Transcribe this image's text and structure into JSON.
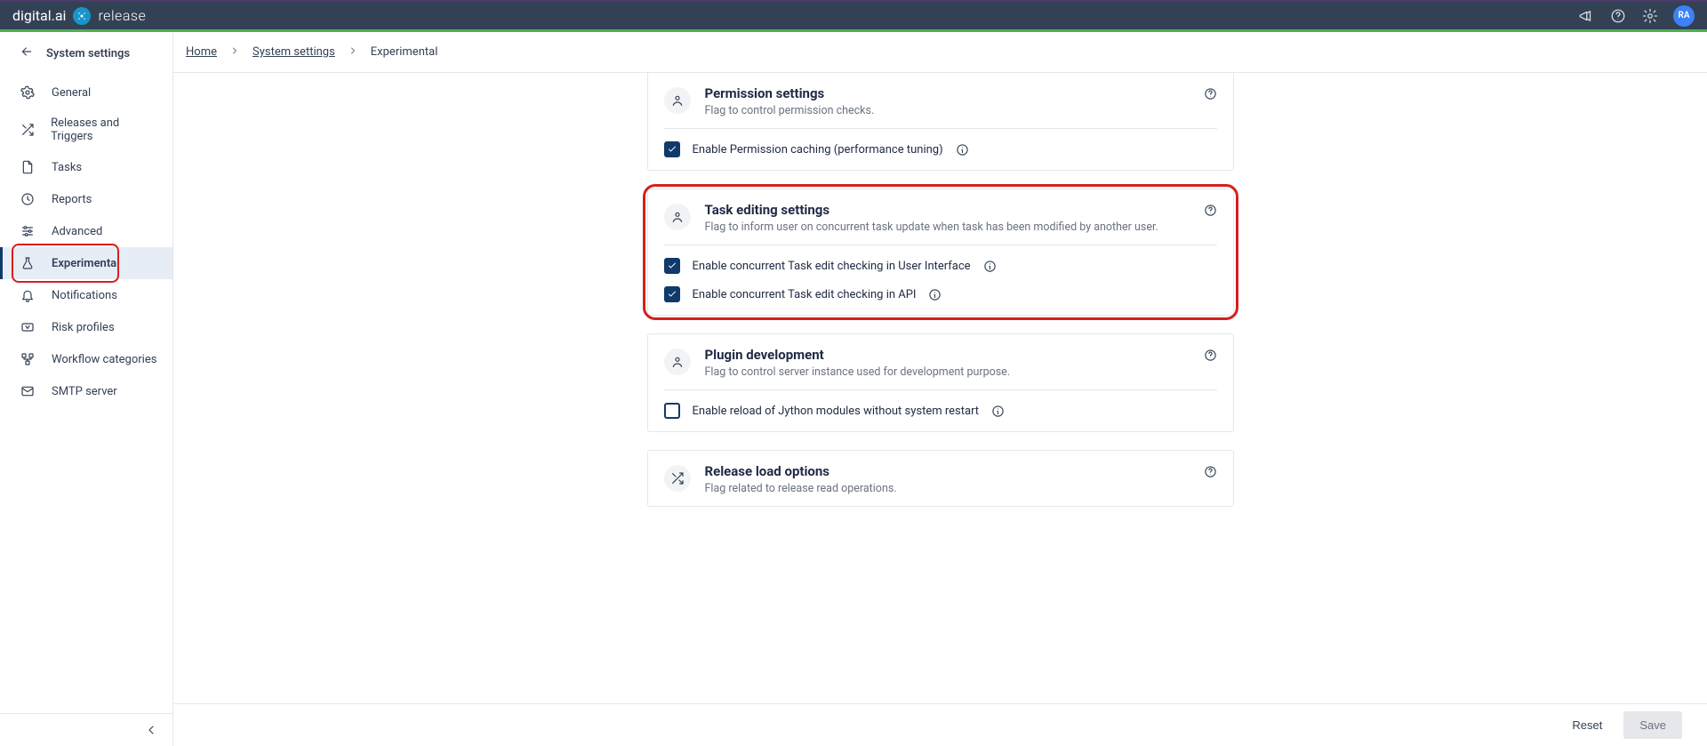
{
  "brand": {
    "main": "digital.ai",
    "product": "release"
  },
  "topbar": {
    "avatar_initials": "RA"
  },
  "sidebar": {
    "title": "System settings",
    "items": [
      {
        "label": "General"
      },
      {
        "label": "Releases and Triggers"
      },
      {
        "label": "Tasks"
      },
      {
        "label": "Reports"
      },
      {
        "label": "Advanced"
      },
      {
        "label": "Experimental"
      },
      {
        "label": "Notifications"
      },
      {
        "label": "Risk profiles"
      },
      {
        "label": "Workflow categories"
      },
      {
        "label": "SMTP server"
      }
    ]
  },
  "breadcrumbs": {
    "home": "Home",
    "mid": "System settings",
    "leaf": "Experimental"
  },
  "cards": {
    "permission": {
      "title": "Permission settings",
      "sub": "Flag to control permission checks.",
      "row1": "Enable Permission caching (performance tuning)"
    },
    "taskedit": {
      "title": "Task editing settings",
      "sub": "Flag to inform user on concurrent task update when task has been modified by another user.",
      "row1": "Enable concurrent Task edit checking in User Interface",
      "row2": "Enable concurrent Task edit checking in API"
    },
    "plugin": {
      "title": "Plugin development",
      "sub": "Flag to control server instance used for development purpose.",
      "row1": "Enable reload of Jython modules without system restart"
    },
    "releaseload": {
      "title": "Release load options",
      "sub": "Flag related to release read operations."
    }
  },
  "actions": {
    "reset": "Reset",
    "save": "Save"
  }
}
